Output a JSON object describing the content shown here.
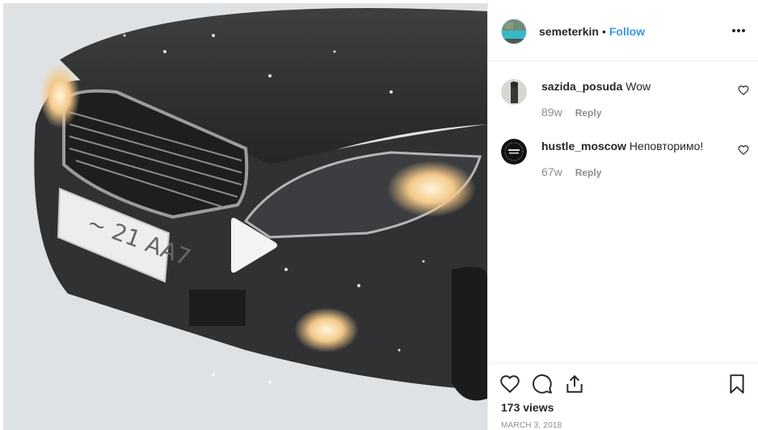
{
  "post": {
    "media": {
      "type": "video",
      "description_icon": "play-icon"
    },
    "header": {
      "username": "semeterkin",
      "separator": "•",
      "follow_label": "Follow",
      "more_icon": "more-options-icon"
    },
    "comments": [
      {
        "username": "sazida_posuda",
        "text": "Wow",
        "time": "89w",
        "reply_label": "Reply"
      },
      {
        "username": "hustle_moscow",
        "text": "Неповторимо!",
        "time": "67w",
        "reply_label": "Reply"
      }
    ],
    "actions": {
      "icons": [
        "heart-icon",
        "comment-icon",
        "share-icon",
        "bookmark-icon"
      ],
      "views": "173 views",
      "date": "MARCH 3, 2018"
    },
    "colors": {
      "follow": "#3897f0",
      "text": "#262626",
      "muted": "#8e8e8e",
      "border": "#efefef"
    }
  }
}
